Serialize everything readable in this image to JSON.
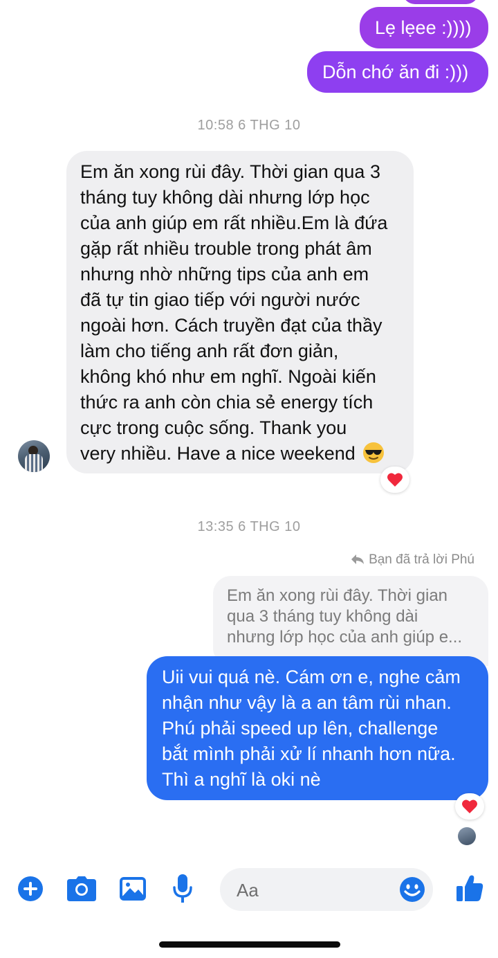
{
  "conversation": {
    "top_outgoing": [
      {
        "text": "Lẹ lẹee :))))"
      },
      {
        "text": "Dỗn chớ ăn đi :)))"
      }
    ],
    "timestamp_1": "10:58 6 THG 10",
    "incoming_message": {
      "lines": [
        "Em ăn xong rùi đây. Thời gian qua 3",
        "tháng tuy không dài nhưng lớp học",
        "của anh giúp em rất nhiều.Em là đứa",
        "gặp rất nhiều trouble trong phát âm",
        "nhưng nhờ những tips của anh em",
        "đã tự tin giao tiếp với người nước",
        "ngoài hơn. Cách truyền đạt của thầy",
        "làm cho tiếng anh rất đơn giản,",
        "không khó như em nghĩ. Ngoài kiến",
        "thức ra anh còn chia sẻ energy tích",
        "cực trong cuộc sống. Thank you",
        "very nhiều. Have a nice weekend"
      ],
      "emoji": "sunglasses-emoji",
      "reaction": "heart"
    },
    "timestamp_2": "13:35 6 THG 10",
    "reply_label": "Bạn đã trả lời Phú",
    "quoted_preview": [
      "Em ăn xong rùi đây. Thời gian",
      "qua 3 tháng tuy không dài",
      "nhưng lớp học của anh giúp e..."
    ],
    "reply_message": {
      "lines": [
        "Uii vui quá nè. Cám ơn e, nghe cảm",
        "nhận như vậy là a an tâm rùi nhan.",
        "Phú phải speed up lên, challenge",
        "bắt mình phải xử lí nhanh hơn nữa.",
        "Thì a nghĩ là oki nè"
      ],
      "reaction": "heart"
    }
  },
  "composer": {
    "placeholder": "Aa",
    "icons": [
      "plus-icon",
      "camera-icon",
      "image-icon",
      "microphone-icon",
      "emoji-icon",
      "thumbs-up-icon"
    ]
  },
  "colors": {
    "outgoing_purple": "#9a3de8",
    "outgoing_blue": "#2a6ef2",
    "incoming_gray": "#efeff1",
    "icon_blue": "#1a73e8",
    "heart_red": "#f0283c"
  }
}
